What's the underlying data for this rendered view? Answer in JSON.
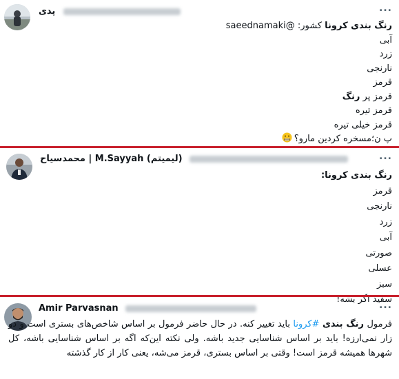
{
  "tweet1": {
    "name": "پدی",
    "more_label": "...",
    "lines": [
      {
        "bold": "رنگ بندی کرونا",
        "rest": " کشور: @saeednamaki"
      },
      {
        "text": "آبی"
      },
      {
        "text": "زرد"
      },
      {
        "text": "نارنجی"
      },
      {
        "text": "قرمز"
      },
      {
        "pre": "قرمز پر ",
        "bold": "رنگ"
      },
      {
        "text": "قرمز تیره"
      },
      {
        "text": "قرمز خیلی تیره"
      },
      {
        "text": "پ ن؛مسخره کردین مارو؟"
      }
    ],
    "emoji": "grimacing-face-emoji"
  },
  "tweet2": {
    "name_persian": "محمدسیاح",
    "name_separator": " | ",
    "name_latin": "M.Sayyah",
    "name_paren": "(لیمیتم)",
    "more_label": "...",
    "lines": [
      {
        "bold": "رنگ بندی کرونا:"
      },
      {
        "text": "قرمز"
      },
      {
        "text": "نارنجی"
      },
      {
        "text": "زرد"
      },
      {
        "text": "آبی"
      },
      {
        "text": "صورتی"
      },
      {
        "text": "عسلی"
      },
      {
        "text": "سبز"
      },
      {
        "text": "سفید اگر بشه!"
      }
    ]
  },
  "tweet3": {
    "name": "Amir Parvasnan",
    "more_label": "...",
    "text_pre": "فرمول ",
    "text_bold": "رنگ بندی",
    "text_space": " ",
    "hashtag": "#کرونا",
    "text_rest": " باید تغییر کنه. در حال حاضر فرمول بر اساس شاخص‌های بستری است و دو زار نمی‌ارزه! باید بر اساس شناسایی جدید باشه. ولی نکته این‌که اگه بر اساس شناسایی باشه، کل شهرها همیشه قرمز است! وقتی بر اساس بستری، قرمز می‌شه، یعنی کار از کار گذشته"
  },
  "colors": {
    "divider": "#c8202c",
    "link": "#1d9bf0",
    "text": "#0f1419",
    "secondary": "#536471"
  }
}
